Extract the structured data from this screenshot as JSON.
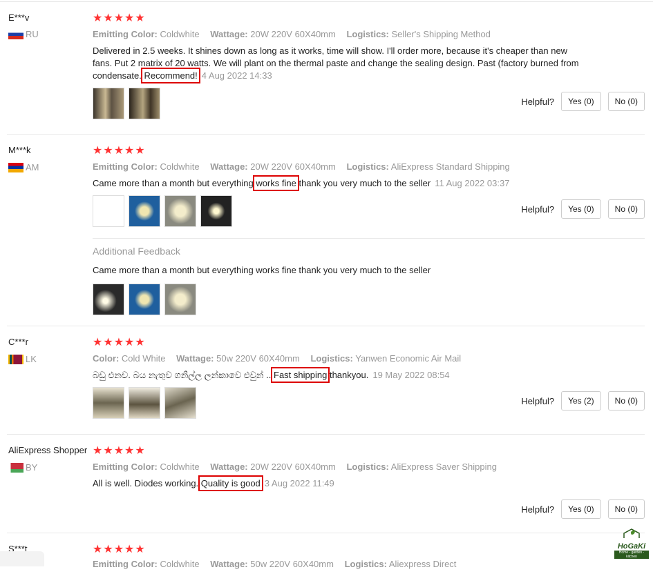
{
  "labels": {
    "helpful": "Helpful?",
    "emitting_color": "Emitting Color:",
    "color": "Color:",
    "wattage": "Wattage:",
    "logistics": "Logistics:",
    "additional_feedback": "Additional Feedback",
    "stars": "★★★★★"
  },
  "reviews": [
    {
      "user": "E***v",
      "country": "RU",
      "color_value": "Coldwhite",
      "wattage": "20W 220V 60X40mm",
      "logistics": "Seller's Shipping Method",
      "text_before": "Delivered in 2.5 weeks. It shines down as long as it works, time will show. I'll order more, because it's cheaper than new fans. Put 2 matrix of 20 watts. We will plant on the thermal paste and change the sealing design. Past (factory burned from condensate.",
      "text_highlight": "Recommend!",
      "text_after": "",
      "date": "4 Aug 2022 14:33",
      "yes": "Yes (0)",
      "no": "No (0)"
    },
    {
      "user": "M***k",
      "country": "AM",
      "color_value": "Coldwhite",
      "wattage": "20W 220V 60X40mm",
      "logistics": "AliExpress Standard Shipping",
      "text_before": "Came more than a month but everything",
      "text_highlight": "works fine",
      "text_after": "thank you very much to the seller",
      "date": "11 Aug 2022 03:37",
      "yes": "Yes (0)",
      "no": "No (0)",
      "additional_text": "Came more than a month but everything works fine thank you very much to the seller"
    },
    {
      "user": "C***r",
      "country": "LK",
      "color_value": "Cold White",
      "wattage": "50w 220V 60X40mm",
      "logistics": "Yanwen Economic Air Mail",
      "text_before": "බඩු එනව. බය නැතුව ගනිල්ල ලන්කාවෙ එවුන් ..",
      "text_highlight": "Fast shipping",
      "text_after": "thankyou.",
      "date": "19 May 2022 08:54",
      "yes": "Yes (2)",
      "no": "No (0)"
    },
    {
      "user": "AliExpress Shopper",
      "country": "BY",
      "color_value": "Coldwhite",
      "wattage": "20W 220V 60X40mm",
      "logistics": "AliExpress Saver Shipping",
      "text_before": "All is well. Diodes working.",
      "text_highlight": "Quality is good",
      "text_after": "",
      "date": "3 Aug 2022 11:49",
      "yes": "Yes (0)",
      "no": "No (0)"
    },
    {
      "user": "S***t",
      "color_value": "Coldwhite",
      "wattage": "50w 220V 60X40mm",
      "logistics": "Aliexpress Direct"
    }
  ],
  "watermark": {
    "name": "HoGaKi",
    "tagline": "Home - garden - kitchen"
  }
}
